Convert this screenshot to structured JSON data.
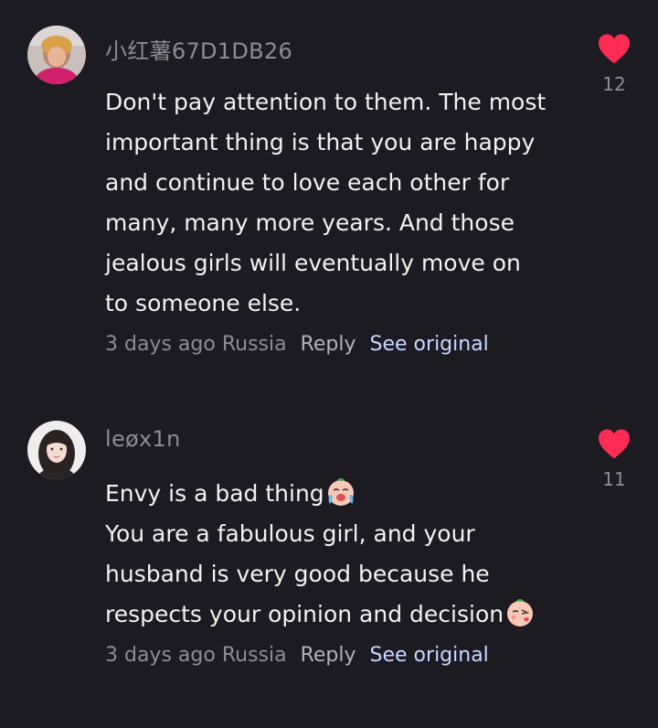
{
  "comments": [
    {
      "username": "小红薯67D1DB26",
      "lines": [
        "Don't pay attention to them. The most",
        "important thing is that you are happy",
        "and continue to love each other for",
        "many, many more years. And those",
        "jealous girls will eventually move on",
        "to someone else."
      ],
      "time": "3 days ago",
      "location": "Russia",
      "reply_label": "Reply",
      "see_original_label": "See original",
      "likes": "12",
      "avatar_icon": "user-photo-avatar"
    },
    {
      "username": "leøx1n",
      "lines": [
        "Envy is a bad thing",
        "You are a fabulous girl, and your",
        "husband is very good because he",
        "respects your opinion and decision"
      ],
      "time": "3 days ago",
      "location": "Russia",
      "reply_label": "Reply",
      "see_original_label": "See original",
      "likes": "11",
      "avatar_icon": "user-photo-avatar",
      "emojis": [
        "crying-face-sticker",
        "blowing-kiss-face-sticker"
      ]
    }
  ],
  "colors": {
    "background": "#1c1b22",
    "heart": "#fe2c55",
    "link": "#c9d8ff",
    "muted": "#8d8c94"
  }
}
